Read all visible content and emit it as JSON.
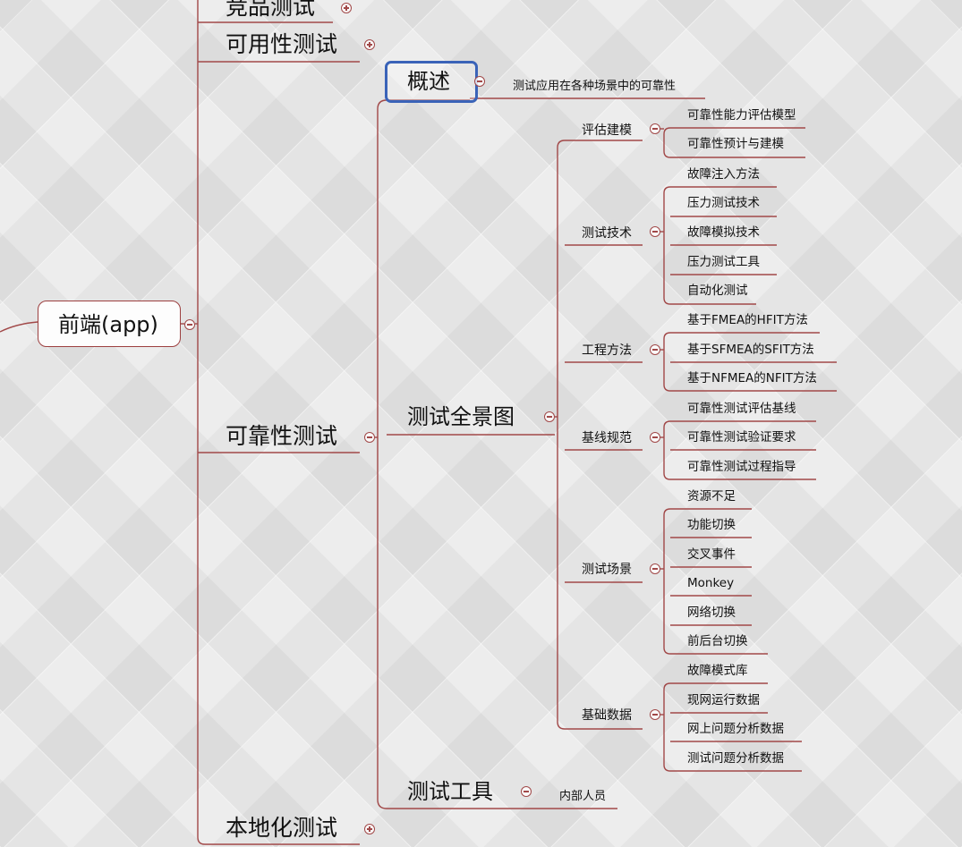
{
  "root": {
    "label": "前端(app)"
  },
  "branches": {
    "competitor": "竞品测试",
    "usability": "可用性测试",
    "reliability": "可靠性测试",
    "localization": "本地化测试"
  },
  "reliability": {
    "overview": {
      "label": "概述",
      "note": "测试应用在各种场景中的可靠性"
    },
    "panorama": {
      "label": "测试全景图",
      "groups": [
        {
          "label": "评估建模",
          "items": [
            "可靠性能力评估模型",
            "可靠性预计与建模"
          ]
        },
        {
          "label": "测试技术",
          "items": [
            "故障注入方法",
            "压力测试技术",
            "故障模拟技术",
            "压力测试工具",
            "自动化测试"
          ]
        },
        {
          "label": "工程方法",
          "items": [
            "基于FMEA的HFIT方法",
            "基于SFMEA的SFIT方法",
            "基于NFMEA的NFIT方法"
          ]
        },
        {
          "label": "基线规范",
          "items": [
            "可靠性测试评估基线",
            "可靠性测试验证要求",
            "可靠性测试过程指导"
          ]
        },
        {
          "label": "测试场景",
          "items": [
            "资源不足",
            "功能切换",
            "交叉事件",
            "Monkey",
            "网络切换",
            "前后台切换"
          ]
        },
        {
          "label": "基础数据",
          "items": [
            "故障模式库",
            "现网运行数据",
            "网上问题分析数据",
            "测试问题分析数据"
          ]
        }
      ]
    },
    "tools": {
      "label": "测试工具",
      "note": "内部人员"
    }
  },
  "colors": {
    "line": "#a14848",
    "root_border": "#9c3f3f",
    "selection": "#3a63b8"
  }
}
